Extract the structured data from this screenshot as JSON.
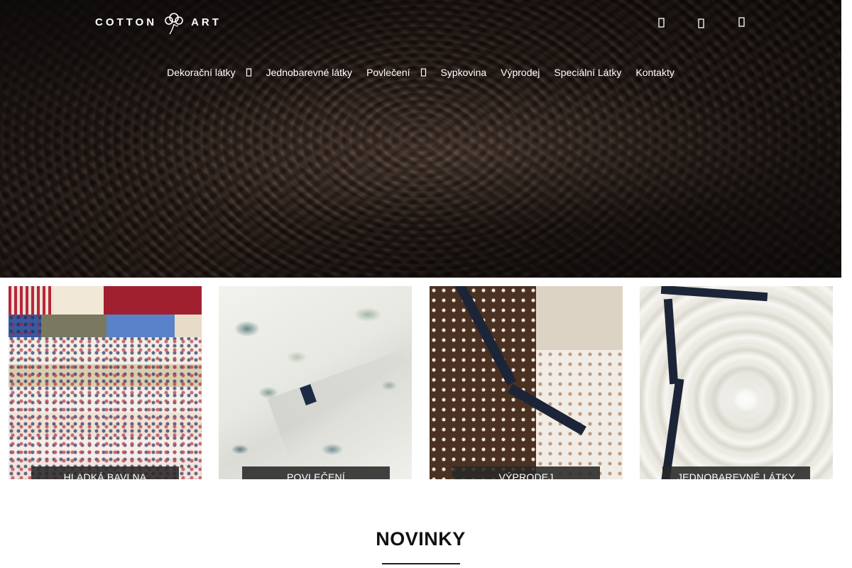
{
  "header": {
    "logo": {
      "left_text": "COTTON",
      "right_text": "ART"
    },
    "icons": [
      "user-icon",
      "heart-icon",
      "cart-icon"
    ]
  },
  "nav": {
    "items": [
      {
        "label": "Dekorační látky",
        "has_dropdown": true
      },
      {
        "label": "Jednobarevné látky",
        "has_dropdown": false
      },
      {
        "label": "Povlečení",
        "has_dropdown": true
      },
      {
        "label": "Sypkovina",
        "has_dropdown": false
      },
      {
        "label": "Výprodej",
        "has_dropdown": false
      },
      {
        "label": "Speciální Látky",
        "has_dropdown": false
      },
      {
        "label": "Kontakty",
        "has_dropdown": false
      }
    ]
  },
  "categories": [
    {
      "label": "HLADKÁ BAVLNA"
    },
    {
      "label": "POVLEČENÍ"
    },
    {
      "label": "VÝPRODEJ"
    },
    {
      "label": "JEDNOBAREVNÉ LÁTKY"
    }
  ],
  "section": {
    "title": "NOVINKY"
  },
  "colors": {
    "label_bg": "#282828",
    "text_light": "#ffffff",
    "ribbon": "#1c2538"
  }
}
